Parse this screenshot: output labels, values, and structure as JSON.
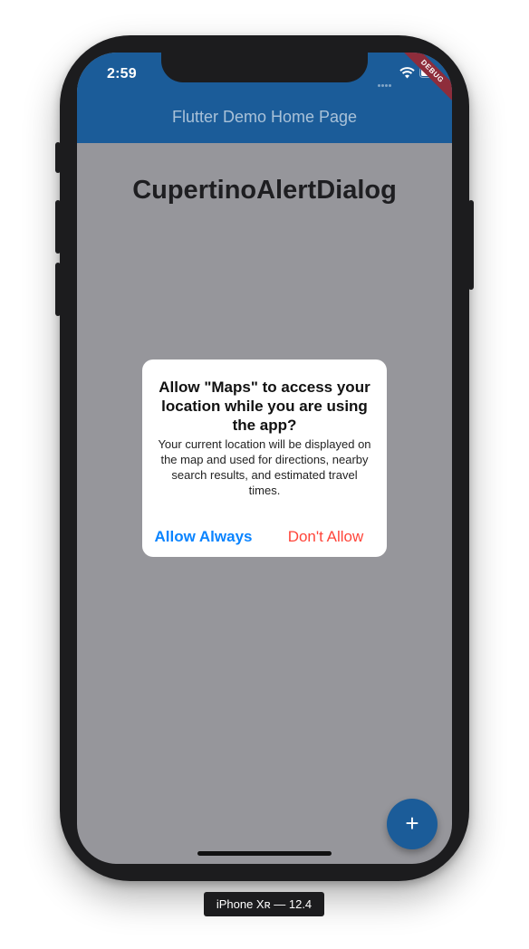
{
  "status_bar": {
    "time": "2:59"
  },
  "app_bar": {
    "title": "Flutter Demo Home Page",
    "debug_banner": "DEBUG"
  },
  "page": {
    "heading": "CupertinoAlertDialog"
  },
  "dialog": {
    "title": "Allow \"Maps\" to access your location while you are using the app?",
    "message": "Your current location will be displayed on the map and used for directions, nearby search results, and estimated travel times.",
    "actions": [
      {
        "label": "Allow Always",
        "color": "#0a84ff"
      },
      {
        "label": "Don't Allow",
        "color": "#ff453a"
      }
    ]
  },
  "fab": {
    "icon": "add-icon",
    "glyph": "+"
  },
  "device_label": "iPhone Xʀ — 12.4",
  "colors": {
    "primary": "#1b5c99",
    "scrim": "#96969b",
    "debug": "#8e2d3b"
  }
}
